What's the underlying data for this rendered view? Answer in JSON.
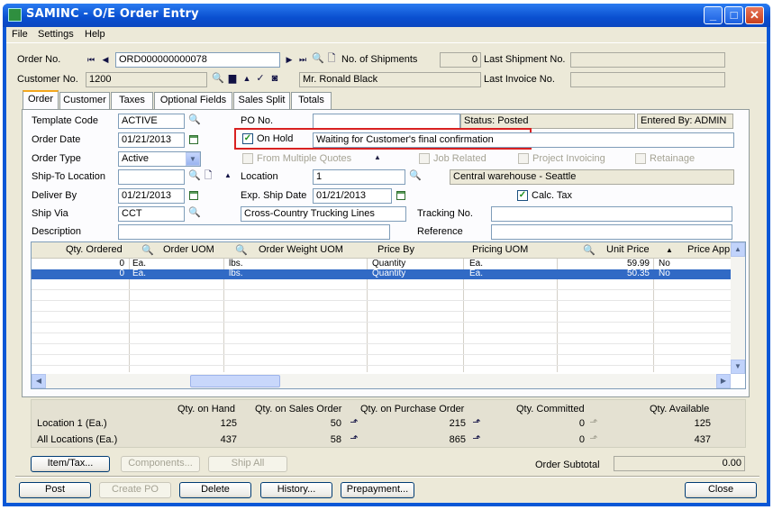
{
  "window": {
    "title": "SAMINC - O/E Order Entry",
    "min": "_",
    "max": "□",
    "close": "✕"
  },
  "menu": [
    "File",
    "Settings",
    "Help"
  ],
  "header": {
    "order_no_label": "Order No.",
    "order_no": "ORD000000000078",
    "no_shipments_label": "No. of Shipments",
    "no_shipments": "0",
    "last_shipment_label": "Last Shipment No.",
    "last_shipment": "",
    "customer_no_label": "Customer No.",
    "customer_no": "1200",
    "customer_name": "Mr. Ronald Black",
    "last_invoice_label": "Last Invoice No.",
    "last_invoice": ""
  },
  "tabs": [
    "Order",
    "Customer",
    "Taxes",
    "Optional Fields",
    "Sales Split",
    "Totals"
  ],
  "order": {
    "template_code_label": "Template Code",
    "template_code": "ACTIVE",
    "po_no_label": "PO No.",
    "po_no": "",
    "status": "Status: Posted",
    "entered_by": "Entered By: ADMIN",
    "order_date_label": "Order Date",
    "order_date": "01/21/2013",
    "on_hold_label": "On Hold",
    "on_hold_reason": "Waiting for Customer's final confirmation",
    "order_type_label": "Order Type",
    "order_type": "Active",
    "from_multiple_quotes": "From Multiple Quotes",
    "job_related": "Job Related",
    "project_invoicing": "Project Invoicing",
    "retainage": "Retainage",
    "ship_to_label": "Ship-To Location",
    "ship_to": "",
    "location_label": "Location",
    "location": "1",
    "location_desc": "Central warehouse - Seattle",
    "deliver_by_label": "Deliver By",
    "deliver_by": "01/21/2013",
    "exp_ship_label": "Exp. Ship Date",
    "exp_ship": "01/21/2013",
    "calc_tax_label": "Calc. Tax",
    "ship_via_label": "Ship Via",
    "ship_via": "CCT",
    "ship_via_desc": "Cross-Country Trucking Lines",
    "tracking_label": "Tracking No.",
    "tracking": "",
    "description_label": "Description",
    "description": "",
    "reference_label": "Reference",
    "reference": ""
  },
  "grid": {
    "columns": [
      "Qty. Ordered",
      "Order UOM",
      "Order Weight UOM",
      "Price By",
      "Pricing UOM",
      "Unit Price",
      "Price App"
    ],
    "rows": [
      {
        "qty": "0",
        "uom": "Ea.",
        "weight_uom": "lbs.",
        "price_by": "Quantity",
        "pricing_uom": "Ea.",
        "unit_price": "59.99",
        "price_app": "No"
      },
      {
        "qty": "0",
        "uom": "Ea.",
        "weight_uom": "lbs.",
        "price_by": "Quantity",
        "pricing_uom": "Ea.",
        "unit_price": "50.35",
        "price_app": "No"
      }
    ]
  },
  "summary": {
    "headers": [
      "Qty. on Hand",
      "Qty. on Sales Order",
      "Qty. on Purchase Order",
      "Qty. Committed",
      "Qty. Available"
    ],
    "rows": [
      {
        "label": "Location  1 (Ea.)",
        "on_hand": "125",
        "on_so": "50",
        "on_po": "215",
        "committed": "0",
        "available": "125"
      },
      {
        "label": "All Locations (Ea.)",
        "on_hand": "437",
        "on_so": "58",
        "on_po": "865",
        "committed": "0",
        "available": "437"
      }
    ]
  },
  "buttons": {
    "item_tax": "Item/Tax...",
    "components": "Components...",
    "ship_all": "Ship All",
    "order_subtotal_label": "Order Subtotal",
    "order_subtotal": "0.00",
    "post": "Post",
    "create_po": "Create PO",
    "delete": "Delete",
    "history": "History...",
    "prepayment": "Prepayment...",
    "close": "Close"
  },
  "colors": {
    "titlebar": "#0a4fd0",
    "selection": "#316ac5",
    "highlight_box": "#d92121",
    "tab_accent": "#f3a71d"
  }
}
